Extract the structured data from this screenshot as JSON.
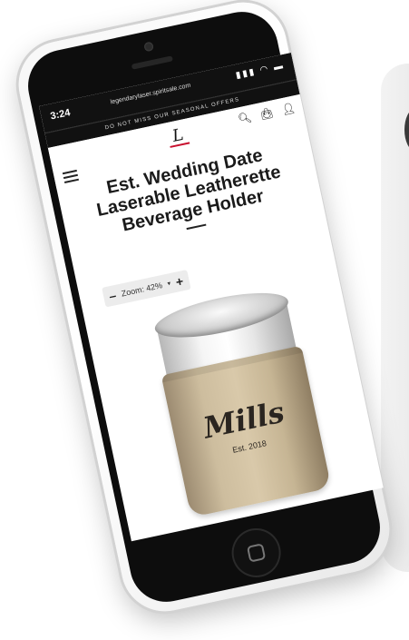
{
  "status": {
    "time": "3:24",
    "url": "legendarylaser.spiritsale.com",
    "icons": "▮▮▮ ◠ ▬"
  },
  "promo": {
    "text": "DO NOT MISS OUR SEASONAL OFFERS"
  },
  "header": {
    "logo_text": "L",
    "search_icon": "search-icon",
    "cart_icon": "cart-icon",
    "account_icon": "account-icon"
  },
  "product": {
    "title": "Est. Wedding Date Laserable Leatherette Beverage Holder",
    "engraving_name": "Mills",
    "engraving_date": "Est. 2018"
  },
  "zoom": {
    "minus": "–",
    "label": "Zoom: 42%",
    "caret": "▾",
    "plus": "+"
  },
  "colors": {
    "koozie": "#cdbd9e",
    "accent": "#c8102e",
    "dark": "#111111"
  }
}
